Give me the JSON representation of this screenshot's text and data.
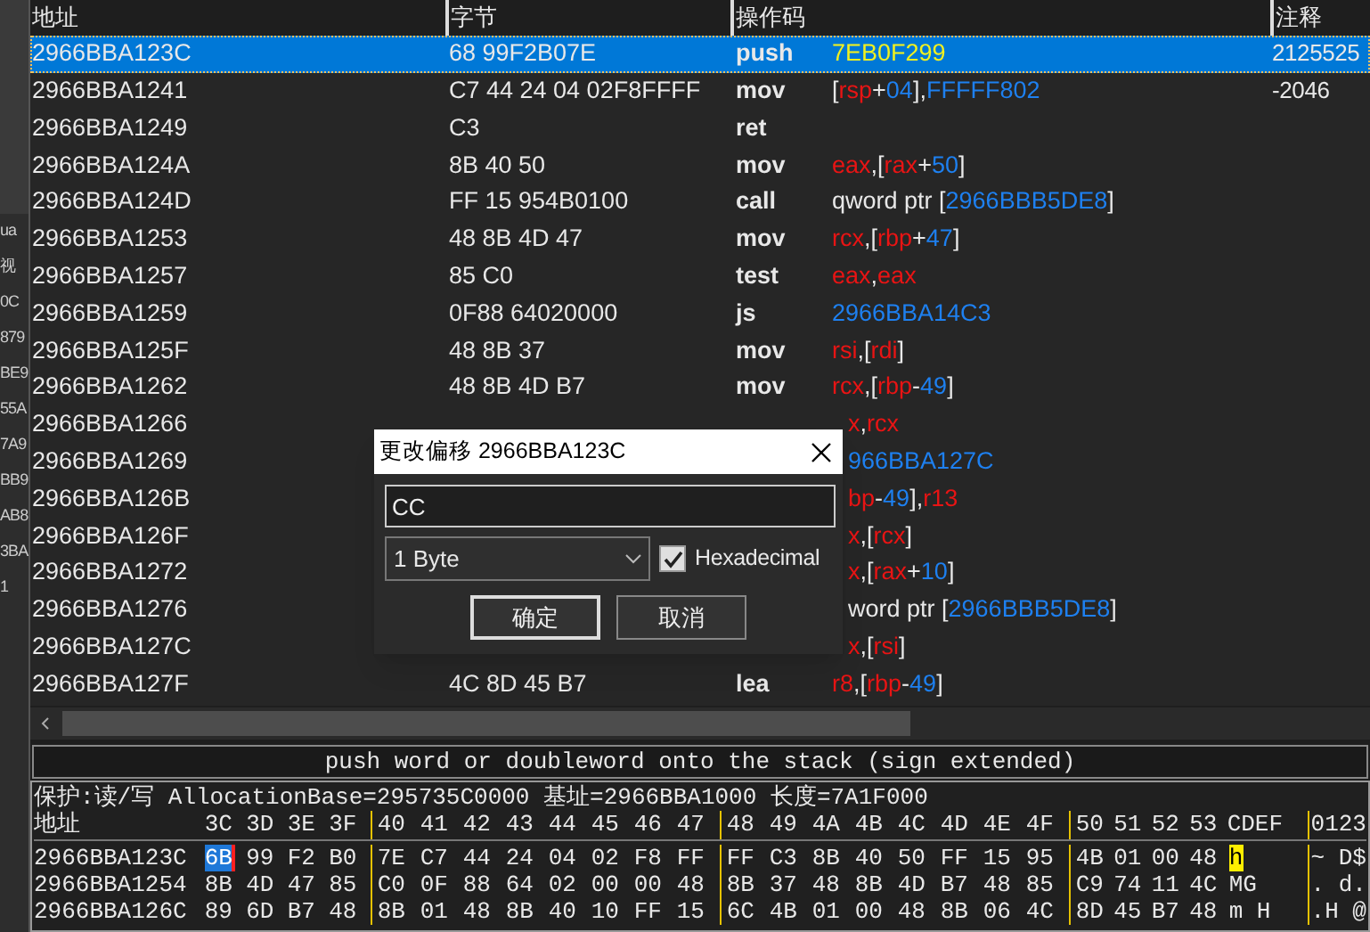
{
  "left_panel": {
    "items": [
      "ua",
      "视",
      "0C",
      "879",
      "BE9",
      "55A",
      "7A9",
      "BB9",
      "AB8",
      "3BA",
      "1"
    ]
  },
  "disassembly": {
    "columns": [
      "地址",
      "字节",
      "操作码",
      "注释"
    ],
    "rows": [
      {
        "address": "2966BBA123C",
        "bytes": "68 99F2B07E",
        "opcode": "push",
        "operands": [
          {
            "kind": "imm",
            "text": "7EB0F299"
          }
        ],
        "comment": "2125525",
        "selected": true
      },
      {
        "address": "2966BBA1241",
        "bytes": "C7 44 24 04 02F8FFFF",
        "opcode": "mov",
        "operands": [
          {
            "kind": "punct",
            "text": "["
          },
          {
            "kind": "reg",
            "text": "rsp"
          },
          {
            "kind": "punct",
            "text": "+"
          },
          {
            "kind": "num",
            "text": "04"
          },
          {
            "kind": "punct",
            "text": "],"
          },
          {
            "kind": "num",
            "text": "FFFFF802"
          }
        ],
        "comment": "-2046",
        "selected": false
      },
      {
        "address": "2966BBA1249",
        "bytes": "C3",
        "opcode": "ret",
        "operands": [],
        "selected": false
      },
      {
        "address": "2966BBA124A",
        "bytes": "8B 40 50",
        "opcode": "mov",
        "operands": [
          {
            "kind": "reg",
            "text": "eax"
          },
          {
            "kind": "punct",
            "text": ",["
          },
          {
            "kind": "reg",
            "text": "rax"
          },
          {
            "kind": "punct",
            "text": "+"
          },
          {
            "kind": "num",
            "text": "50"
          },
          {
            "kind": "punct",
            "text": "]"
          }
        ],
        "selected": false
      },
      {
        "address": "2966BBA124D",
        "bytes": "FF 15 954B0100",
        "opcode": "call",
        "operands": [
          {
            "kind": "text",
            "text": "qword ptr ["
          },
          {
            "kind": "num",
            "text": "2966BBB5DE8"
          },
          {
            "kind": "punct",
            "text": "]"
          }
        ],
        "selected": false
      },
      {
        "address": "2966BBA1253",
        "bytes": "48 8B 4D 47",
        "opcode": "mov",
        "operands": [
          {
            "kind": "reg",
            "text": "rcx"
          },
          {
            "kind": "punct",
            "text": ",["
          },
          {
            "kind": "reg",
            "text": "rbp"
          },
          {
            "kind": "punct",
            "text": "+"
          },
          {
            "kind": "num",
            "text": "47"
          },
          {
            "kind": "punct",
            "text": "]"
          }
        ],
        "selected": false
      },
      {
        "address": "2966BBA1257",
        "bytes": "85 C0",
        "opcode": "test",
        "operands": [
          {
            "kind": "reg",
            "text": "eax"
          },
          {
            "kind": "punct",
            "text": ","
          },
          {
            "kind": "reg",
            "text": "eax"
          }
        ],
        "selected": false
      },
      {
        "address": "2966BBA1259",
        "bytes": "0F88 64020000",
        "opcode": "js",
        "operands": [
          {
            "kind": "num",
            "text": "2966BBA14C3"
          }
        ],
        "selected": false
      },
      {
        "address": "2966BBA125F",
        "bytes": "48 8B 37",
        "opcode": "mov",
        "operands": [
          {
            "kind": "reg",
            "text": "rsi"
          },
          {
            "kind": "punct",
            "text": ",["
          },
          {
            "kind": "reg",
            "text": "rdi"
          },
          {
            "kind": "punct",
            "text": "]"
          }
        ],
        "selected": false
      },
      {
        "address": "2966BBA1262",
        "bytes": "48 8B 4D B7",
        "opcode": "mov",
        "operands": [
          {
            "kind": "reg",
            "text": "rcx"
          },
          {
            "kind": "punct",
            "text": ",["
          },
          {
            "kind": "reg",
            "text": "rbp"
          },
          {
            "kind": "punct",
            "text": "-"
          },
          {
            "kind": "num",
            "text": "49"
          },
          {
            "kind": "punct",
            "text": "]"
          }
        ],
        "selected": false
      },
      {
        "address": "2966BBA1266",
        "operands": [
          {
            "kind": "reg",
            "text": "x"
          },
          {
            "kind": "punct",
            "text": ","
          },
          {
            "kind": "reg",
            "text": "rcx"
          }
        ],
        "selected": false
      },
      {
        "address": "2966BBA1269",
        "operands": [
          {
            "kind": "num",
            "text": "966BBA127C"
          }
        ],
        "selected": false
      },
      {
        "address": "2966BBA126B",
        "operands": [
          {
            "kind": "reg",
            "text": "bp"
          },
          {
            "kind": "punct",
            "text": "-"
          },
          {
            "kind": "num",
            "text": "49"
          },
          {
            "kind": "punct",
            "text": "],"
          },
          {
            "kind": "reg",
            "text": "r13"
          }
        ],
        "selected": false
      },
      {
        "address": "2966BBA126F",
        "operands": [
          {
            "kind": "reg",
            "text": "x"
          },
          {
            "kind": "punct",
            "text": ",["
          },
          {
            "kind": "reg",
            "text": "rcx"
          },
          {
            "kind": "punct",
            "text": "]"
          }
        ],
        "selected": false
      },
      {
        "address": "2966BBA1272",
        "operands": [
          {
            "kind": "reg",
            "text": "x"
          },
          {
            "kind": "punct",
            "text": ",["
          },
          {
            "kind": "reg",
            "text": "rax"
          },
          {
            "kind": "punct",
            "text": "+"
          },
          {
            "kind": "num",
            "text": "10"
          },
          {
            "kind": "punct",
            "text": "]"
          }
        ],
        "selected": false
      },
      {
        "address": "2966BBA1276",
        "operands": [
          {
            "kind": "text",
            "text": "word ptr ["
          },
          {
            "kind": "num",
            "text": "2966BBB5DE8"
          },
          {
            "kind": "punct",
            "text": "]"
          }
        ],
        "selected": false
      },
      {
        "address": "2966BBA127C",
        "operands": [
          {
            "kind": "reg",
            "text": "x"
          },
          {
            "kind": "punct",
            "text": ",["
          },
          {
            "kind": "reg",
            "text": "rsi"
          },
          {
            "kind": "punct",
            "text": "]"
          }
        ],
        "selected": false
      },
      {
        "address": "2966BBA127F",
        "bytes": "4C 8D 45 B7",
        "opcode": "lea",
        "operands": [
          {
            "kind": "reg",
            "text": "r8"
          },
          {
            "kind": "punct",
            "text": ",["
          },
          {
            "kind": "reg",
            "text": "rbp"
          },
          {
            "kind": "punct",
            "text": "-"
          },
          {
            "kind": "num",
            "text": "49"
          },
          {
            "kind": "punct",
            "text": "]"
          }
        ],
        "selected": false
      }
    ]
  },
  "dialog": {
    "title": "更改偏移 2966BBA123C",
    "value": "CC",
    "size": "1 Byte",
    "checkbox": {
      "label": "Hexadecimal",
      "checked": true
    },
    "buttons": [
      "确定",
      "取消"
    ]
  },
  "status_bar": {
    "text": "push word or doubleword onto the stack (sign extended)"
  },
  "hex_dump": {
    "info": "保护:读/写  AllocationBase=295735C0000 基址=2966BBA1000 长度=7A1F000",
    "address_label": "地址",
    "columns": [
      [
        "3C",
        "3D",
        "3E",
        "3F"
      ],
      [
        "40",
        "41",
        "42",
        "43",
        "44",
        "45",
        "46",
        "47"
      ],
      [
        "48",
        "49",
        "4A",
        "4B",
        "4C",
        "4D",
        "4E",
        "4F"
      ],
      [
        "50",
        "51",
        "52",
        "53"
      ]
    ],
    "ascii_header_a": "CDEF",
    "ascii_header_b": "0123",
    "rows": [
      {
        "address": "2966BBA123C",
        "groups": [
          [
            {
              "text": "6B",
              "selected": true
            },
            {
              "text": "99",
              "selected": false
            },
            {
              "text": "F2",
              "selected": false
            },
            {
              "text": "B0",
              "selected": false
            }
          ],
          [
            {
              "text": "7E",
              "selected": false
            },
            {
              "text": "C7",
              "selected": false
            },
            {
              "text": "44",
              "selected": false
            },
            {
              "text": "24",
              "selected": false
            },
            {
              "text": "04",
              "selected": false
            },
            {
              "text": "02",
              "selected": false
            },
            {
              "text": "F8",
              "selected": false
            },
            {
              "text": "FF",
              "selected": false
            }
          ],
          [
            {
              "text": "FF",
              "selected": false
            },
            {
              "text": "C3",
              "selected": false
            },
            {
              "text": "8B",
              "selected": false
            },
            {
              "text": "40",
              "selected": false
            },
            {
              "text": "50",
              "selected": false
            },
            {
              "text": "FF",
              "selected": false
            },
            {
              "text": "15",
              "selected": false
            },
            {
              "text": "95",
              "selected": false
            }
          ],
          [
            {
              "text": "4B",
              "selected": false
            },
            {
              "text": "01",
              "selected": false
            },
            {
              "text": "00",
              "selected": false
            },
            {
              "text": "48",
              "selected": false
            }
          ]
        ],
        "ascii_a": {
          "text": "h",
          "highlighted": true
        },
        "ascii_b": "~ D$"
      },
      {
        "address": "2966BBA1254",
        "groups": [
          [
            {
              "text": "8B",
              "selected": false
            },
            {
              "text": "4D",
              "selected": false
            },
            {
              "text": "47",
              "selected": false
            },
            {
              "text": "85",
              "selected": false
            }
          ],
          [
            {
              "text": "C0",
              "selected": false
            },
            {
              "text": "0F",
              "selected": false
            },
            {
              "text": "88",
              "selected": false
            },
            {
              "text": "64",
              "selected": false
            },
            {
              "text": "02",
              "selected": false
            },
            {
              "text": "00",
              "selected": false
            },
            {
              "text": "00",
              "selected": false
            },
            {
              "text": "48",
              "selected": false
            }
          ],
          [
            {
              "text": "8B",
              "selected": false
            },
            {
              "text": "37",
              "selected": false
            },
            {
              "text": "48",
              "selected": false
            },
            {
              "text": "8B",
              "selected": false
            },
            {
              "text": "4D",
              "selected": false
            },
            {
              "text": "B7",
              "selected": false
            },
            {
              "text": "48",
              "selected": false
            },
            {
              "text": "85",
              "selected": false
            }
          ],
          [
            {
              "text": "C9",
              "selected": false
            },
            {
              "text": "74",
              "selected": false
            },
            {
              "text": "11",
              "selected": false
            },
            {
              "text": "4C",
              "selected": false
            }
          ]
        ],
        "ascii_a": {
          "text": "MG",
          "highlighted": false
        },
        "ascii_b": ". d."
      },
      {
        "address": "2966BBA126C",
        "groups": [
          [
            {
              "text": "89",
              "selected": false
            },
            {
              "text": "6D",
              "selected": false
            },
            {
              "text": "B7",
              "selected": false
            },
            {
              "text": "48",
              "selected": false
            }
          ],
          [
            {
              "text": "8B",
              "selected": false
            },
            {
              "text": "01",
              "selected": false
            },
            {
              "text": "48",
              "selected": false
            },
            {
              "text": "8B",
              "selected": false
            },
            {
              "text": "40",
              "selected": false
            },
            {
              "text": "10",
              "selected": false
            },
            {
              "text": "FF",
              "selected": false
            },
            {
              "text": "15",
              "selected": false
            }
          ],
          [
            {
              "text": "6C",
              "selected": false
            },
            {
              "text": "4B",
              "selected": false
            },
            {
              "text": "01",
              "selected": false
            },
            {
              "text": "00",
              "selected": false
            },
            {
              "text": "48",
              "selected": false
            },
            {
              "text": "8B",
              "selected": false
            },
            {
              "text": "06",
              "selected": false
            },
            {
              "text": "4C",
              "selected": false
            }
          ],
          [
            {
              "text": "8D",
              "selected": false
            },
            {
              "text": "45",
              "selected": false
            },
            {
              "text": "B7",
              "selected": false
            },
            {
              "text": "48",
              "selected": false
            }
          ]
        ],
        "ascii_a": {
          "text": "m H",
          "highlighted": false
        },
        "ascii_b": ".H @"
      }
    ]
  }
}
